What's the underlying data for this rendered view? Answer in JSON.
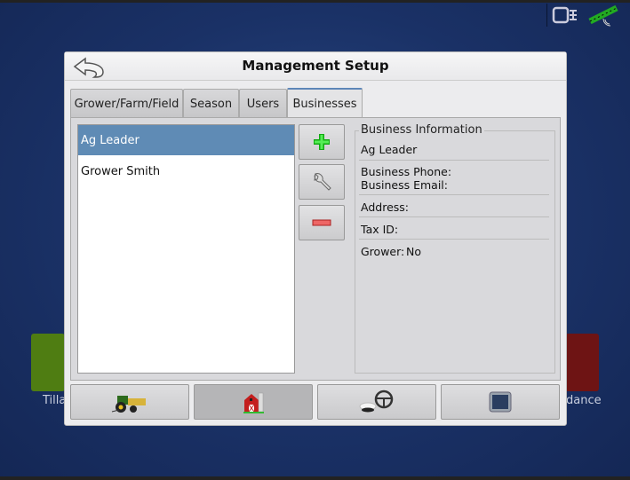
{
  "dialog": {
    "title": "Management Setup",
    "back_icon": "back-arrow-icon"
  },
  "tabs": [
    {
      "label": "Grower/Farm/Field"
    },
    {
      "label": "Season"
    },
    {
      "label": "Users"
    },
    {
      "label": "Businesses",
      "active": true
    }
  ],
  "businesses": [
    {
      "name": "Ag Leader",
      "selected": true
    },
    {
      "name": "Grower Smith"
    }
  ],
  "actions": {
    "add": "plus-icon",
    "edit": "wrench-icon",
    "remove": "minus-icon"
  },
  "info": {
    "title": "Business Information",
    "name": "Ag Leader",
    "phone": "Business Phone:",
    "email": "Business Email:",
    "address": "Address:",
    "tax": "Tax ID:",
    "grower_label": "Grower:",
    "grower_value": "No"
  },
  "bottom_nav": [
    {
      "icon": "tractor-icon"
    },
    {
      "icon": "barn-icon",
      "active": true
    },
    {
      "icon": "steering-wheel-icon"
    },
    {
      "icon": "display-icon"
    }
  ],
  "background": {
    "left_tile_label": "Tilla",
    "right_tile_label": "dance"
  },
  "colors": {
    "selection": "#5f8bb5",
    "background": "#1a3166"
  }
}
